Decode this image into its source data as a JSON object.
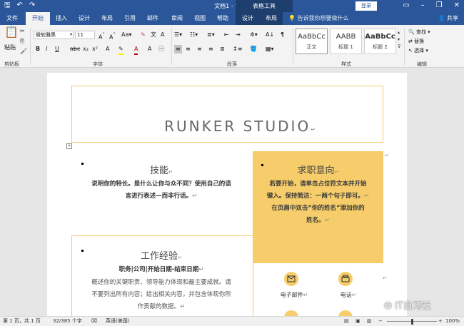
{
  "titlebar": {
    "doc_title": "文档1 - Word",
    "context_tools": "表格工具",
    "login": "登录",
    "qa_icons": [
      "save-icon",
      "undo-icon",
      "redo-icon"
    ]
  },
  "tabs": [
    "文件",
    "开始",
    "插入",
    "设计",
    "布局",
    "引用",
    "邮件",
    "审阅",
    "视图",
    "帮助",
    "设计",
    "布局"
  ],
  "search_placeholder": "告诉我你想要做什么",
  "share": "共享",
  "ribbon": {
    "paste": "粘贴",
    "clipboard": "剪贴板",
    "font_name": "微软雅黑",
    "font_size": "11",
    "font": "字体",
    "paragraph": "段落",
    "styles": "样式",
    "editing": "编辑",
    "style_cards": [
      {
        "sample": "AaBbCc",
        "name": "正文"
      },
      {
        "sample": "AABB",
        "name": "标题 1"
      },
      {
        "sample": "AaBbCc",
        "name": "标题 2"
      }
    ],
    "find": "查找",
    "replace": "替换",
    "select": "选择"
  },
  "page": {
    "studio": "RUNKER STUDIO",
    "skills_title": "技能",
    "skills_line1": "说明你的特长。是什么让你与众不同？使用自己的语",
    "skills_line2": "言进行表述—而非行话。",
    "job_title": "求职意向",
    "job_line1": "若要开始，请单击占位符文本并开始",
    "job_line2": "键入。保持简洁：一两个句子即可。",
    "job_line3": "在页眉中双击“你的姓名”添加你的",
    "job_line4": "姓名。",
    "work_title": "工作经验",
    "work_subtitle": "职务|公司|开始日期-结束日期",
    "work_line1": "概述你的关键职责、领导能力体现和最主要成就。请",
    "work_line2": "不要列出所有内容；给出相关内容，并包含体现你所",
    "work_line3": "作贡献的数据。",
    "email_label": "电子邮件",
    "phone_label": "电话",
    "return_mark": "↵"
  },
  "status": {
    "page": "第 1 页，共 1 页",
    "words": "32/385 个字",
    "lang": "英语(美国)",
    "zoom": "100%"
  },
  "watermark": "IT自习社",
  "colors": {
    "accent": "#2b579a",
    "yellow": "#f6cd6a"
  }
}
